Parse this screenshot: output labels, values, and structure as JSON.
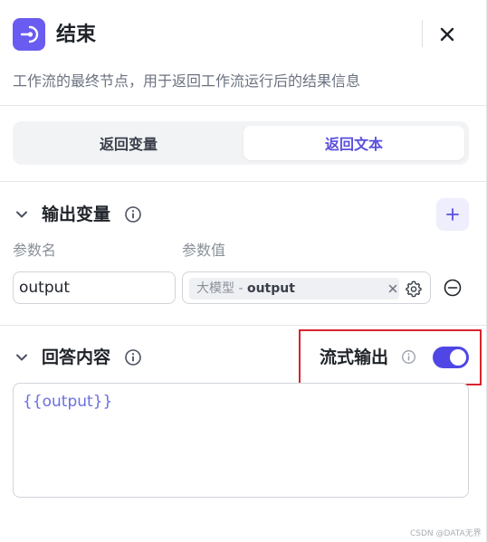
{
  "header": {
    "title": "结束",
    "description": "工作流的最终节点，用于返回工作流运行后的结果信息",
    "icon": "exit-node-icon",
    "close_icon": "close-icon",
    "accent": "#6a5cf0"
  },
  "tabs": [
    {
      "label": "返回变量",
      "active": false
    },
    {
      "label": "返回文本",
      "active": true
    }
  ],
  "output_section": {
    "title": "输出变量",
    "col_name": "参数名",
    "col_value": "参数值",
    "rows": [
      {
        "name": "output",
        "source": "大模型",
        "separator": " - ",
        "variable": "output"
      }
    ]
  },
  "answer_section": {
    "title": "回答内容",
    "stream_label": "流式输出",
    "stream_enabled": true,
    "content": "{{output}}"
  },
  "watermark": "CSDN @DATA无界"
}
